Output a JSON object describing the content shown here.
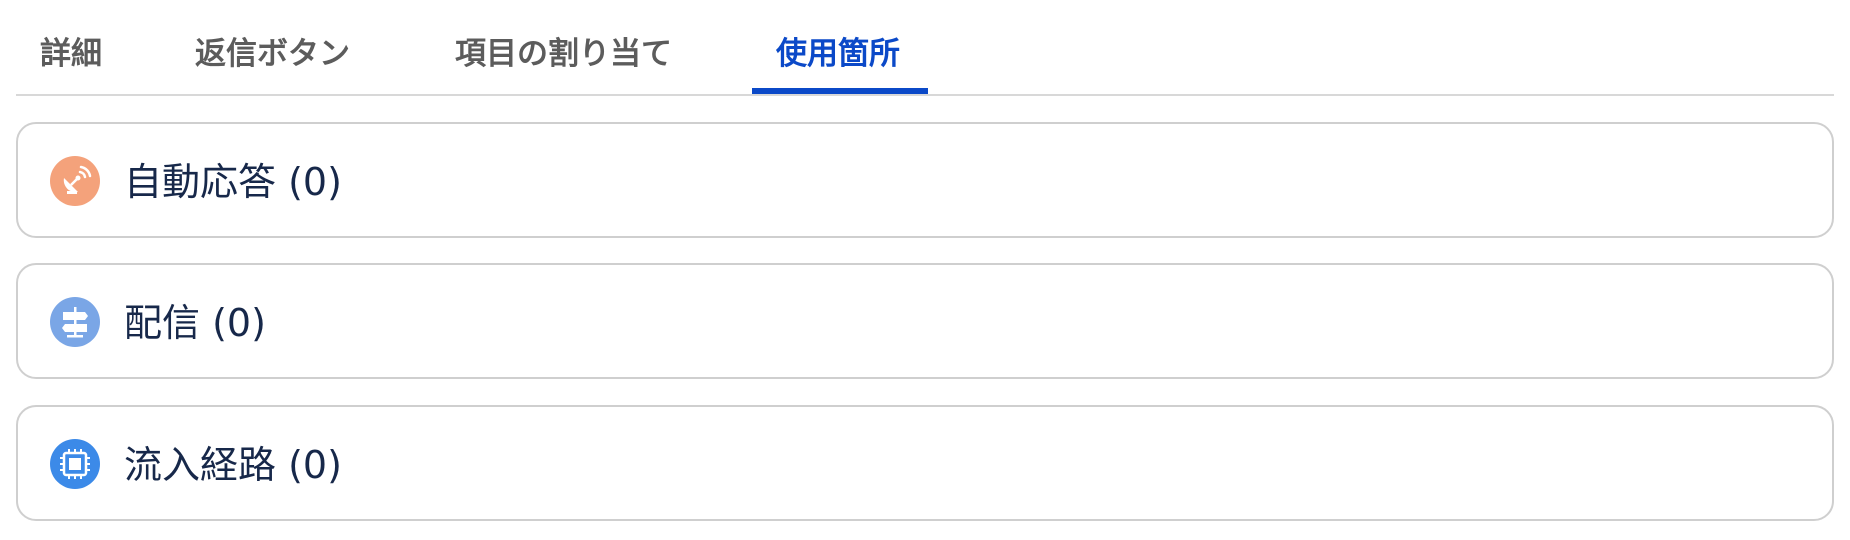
{
  "tabs": [
    {
      "label": "詳細",
      "active": false
    },
    {
      "label": "返信ボタン",
      "active": false
    },
    {
      "label": "項目の割り当て",
      "active": false
    },
    {
      "label": "使用箇所",
      "active": true
    }
  ],
  "sections": [
    {
      "label": "自動応答 (0)",
      "icon": "satellite-dish-icon",
      "color": "#f4a27b"
    },
    {
      "label": "配信 (0)",
      "icon": "signpost-icon",
      "color": "#7aa6e6"
    },
    {
      "label": "流入経路 (0)",
      "icon": "chip-icon",
      "color": "#3c8ae8"
    }
  ],
  "colors": {
    "accent": "#0b49c8",
    "tab_text": "#5c5c5c",
    "title_text": "#17284a",
    "border": "#cfcfcf"
  }
}
